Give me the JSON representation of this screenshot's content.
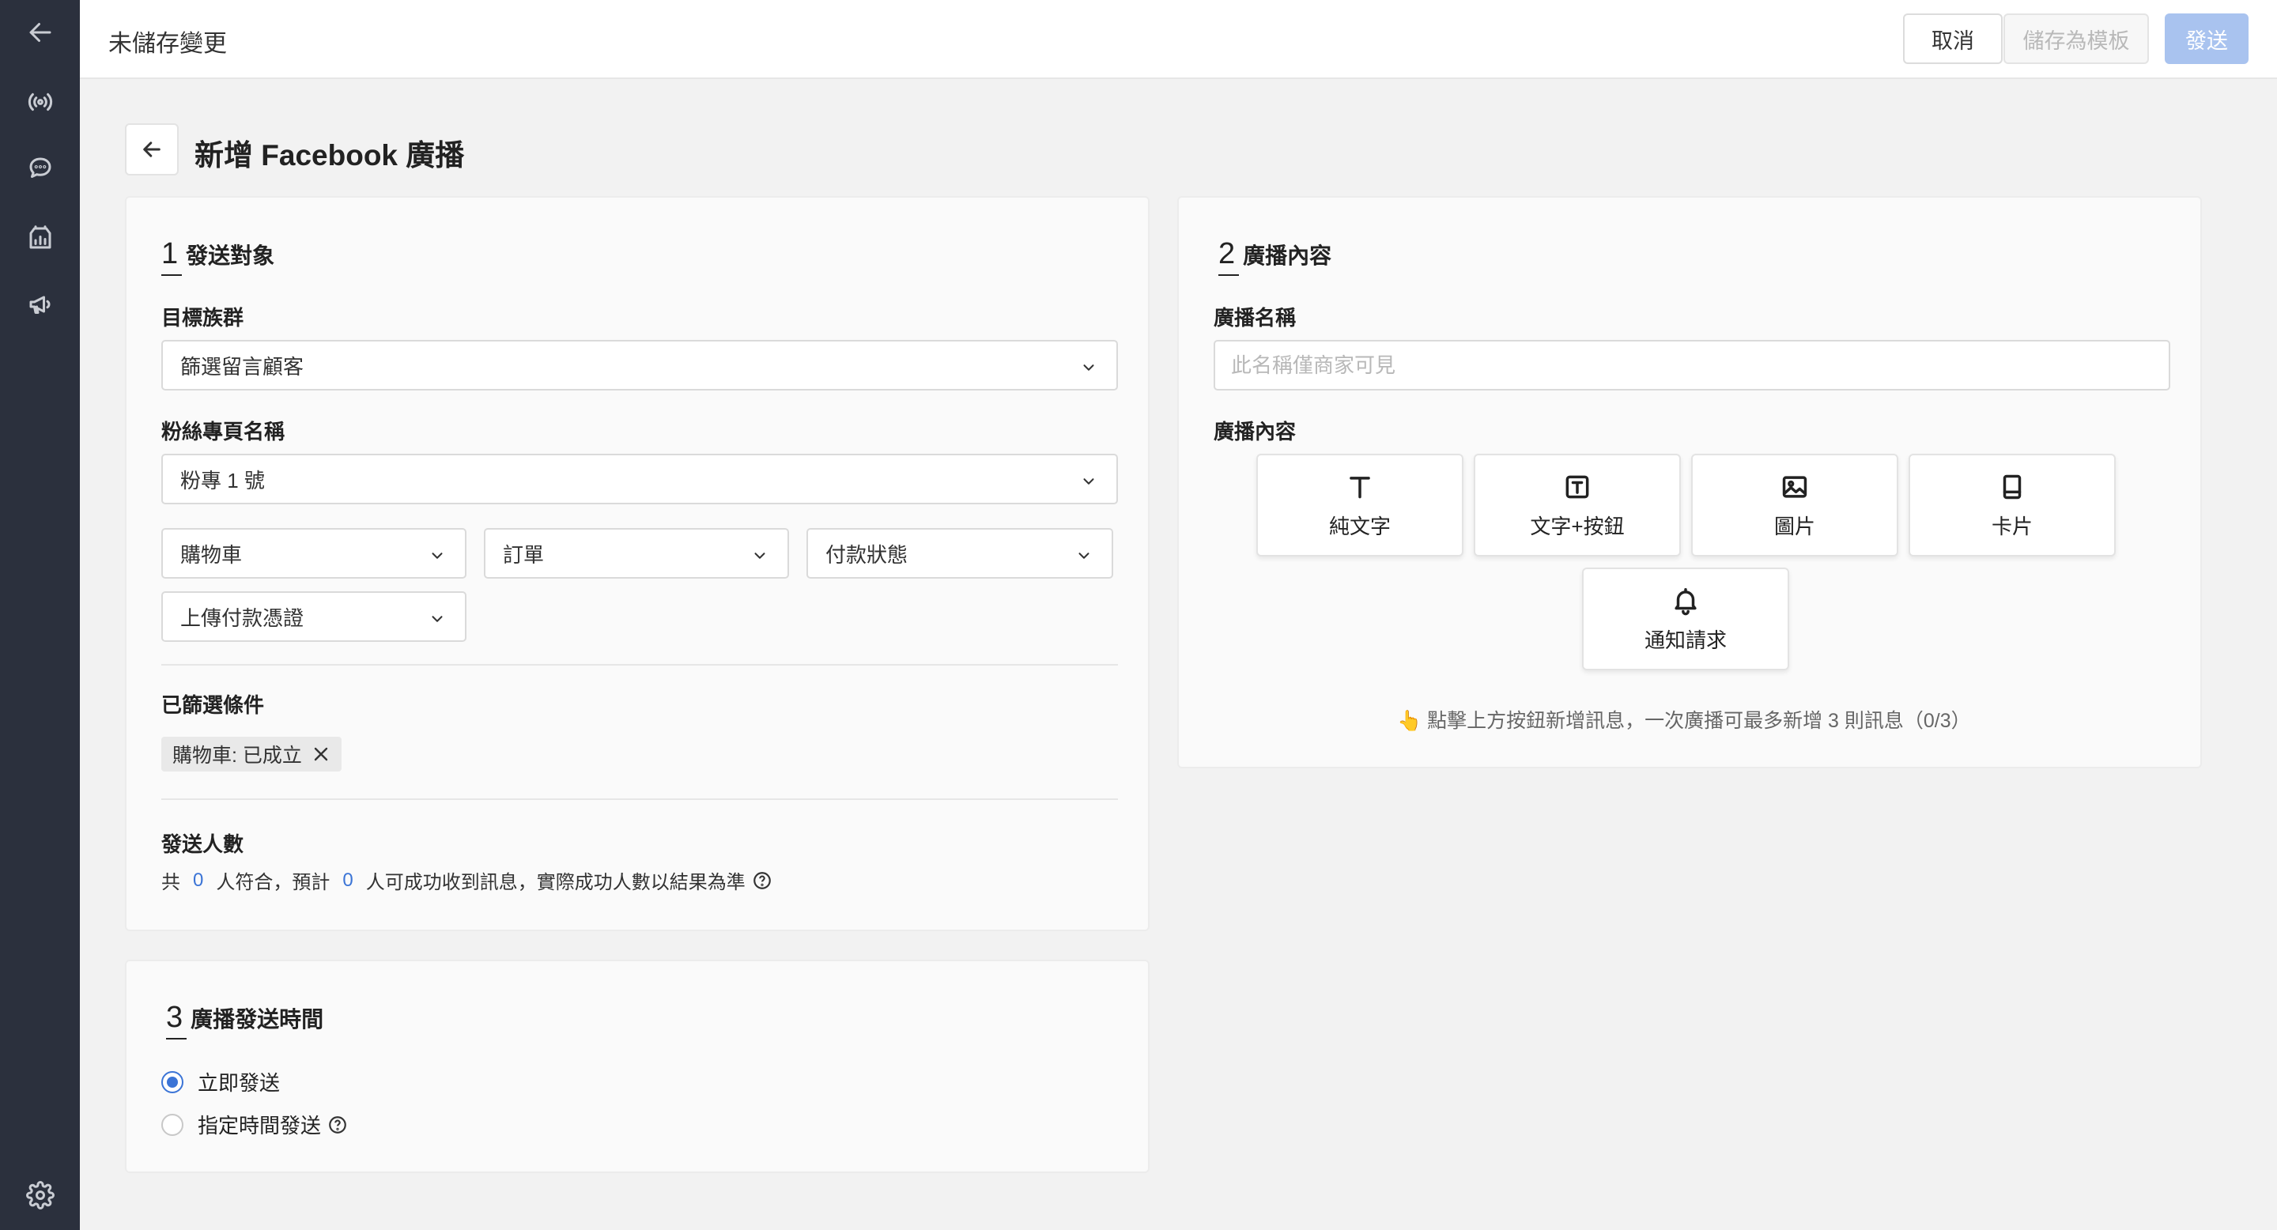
{
  "topbar": {
    "title": "未儲存變更",
    "cancel_label": "取消",
    "save_template_label": "儲存為模板",
    "send_label": "發送"
  },
  "page": {
    "title": "新增 Facebook 廣播"
  },
  "section1": {
    "number": "1",
    "title": "發送對象",
    "target_group_label": "目標族群",
    "target_group_value": "篩選留言顧客",
    "fanpage_label": "粉絲專頁名稱",
    "fanpage_value": "粉專 1 號",
    "filters": [
      "購物車",
      "訂單",
      "付款狀態",
      "上傳付款憑證"
    ],
    "selected_label": "已篩選條件",
    "selected_tag": "購物車: 已成立",
    "count_label": "發送人數",
    "count_text_1": "共",
    "count_matched": "0",
    "count_text_2": "人符合，預計",
    "count_expected": "0",
    "count_text_3": "人可成功收到訊息，實際成功人數以結果為準"
  },
  "section2": {
    "number": "2",
    "title": "廣播內容",
    "name_label": "廣播名稱",
    "name_placeholder": "此名稱僅商家可見",
    "content_label": "廣播內容",
    "tiles": [
      "純文字",
      "文字+按鈕",
      "圖片",
      "卡片",
      "通知請求"
    ],
    "hint": "👆 點擊上方按鈕新增訊息，一次廣播可最多新增 3 則訊息（0/3）"
  },
  "section3": {
    "number": "3",
    "title": "廣播發送時間",
    "option_now": "立即發送",
    "option_scheduled": "指定時間發送",
    "selected": "立即發送"
  },
  "colors": {
    "accent": "#3b74d6",
    "sidebar": "#2b303d",
    "send_disabled": "#a9c3ef"
  },
  "icons": {
    "sidebar": [
      "arrow-left-icon",
      "broadcast-icon",
      "chat-icon",
      "store-chart-icon",
      "megaphone-icon",
      "gear-icon"
    ]
  }
}
